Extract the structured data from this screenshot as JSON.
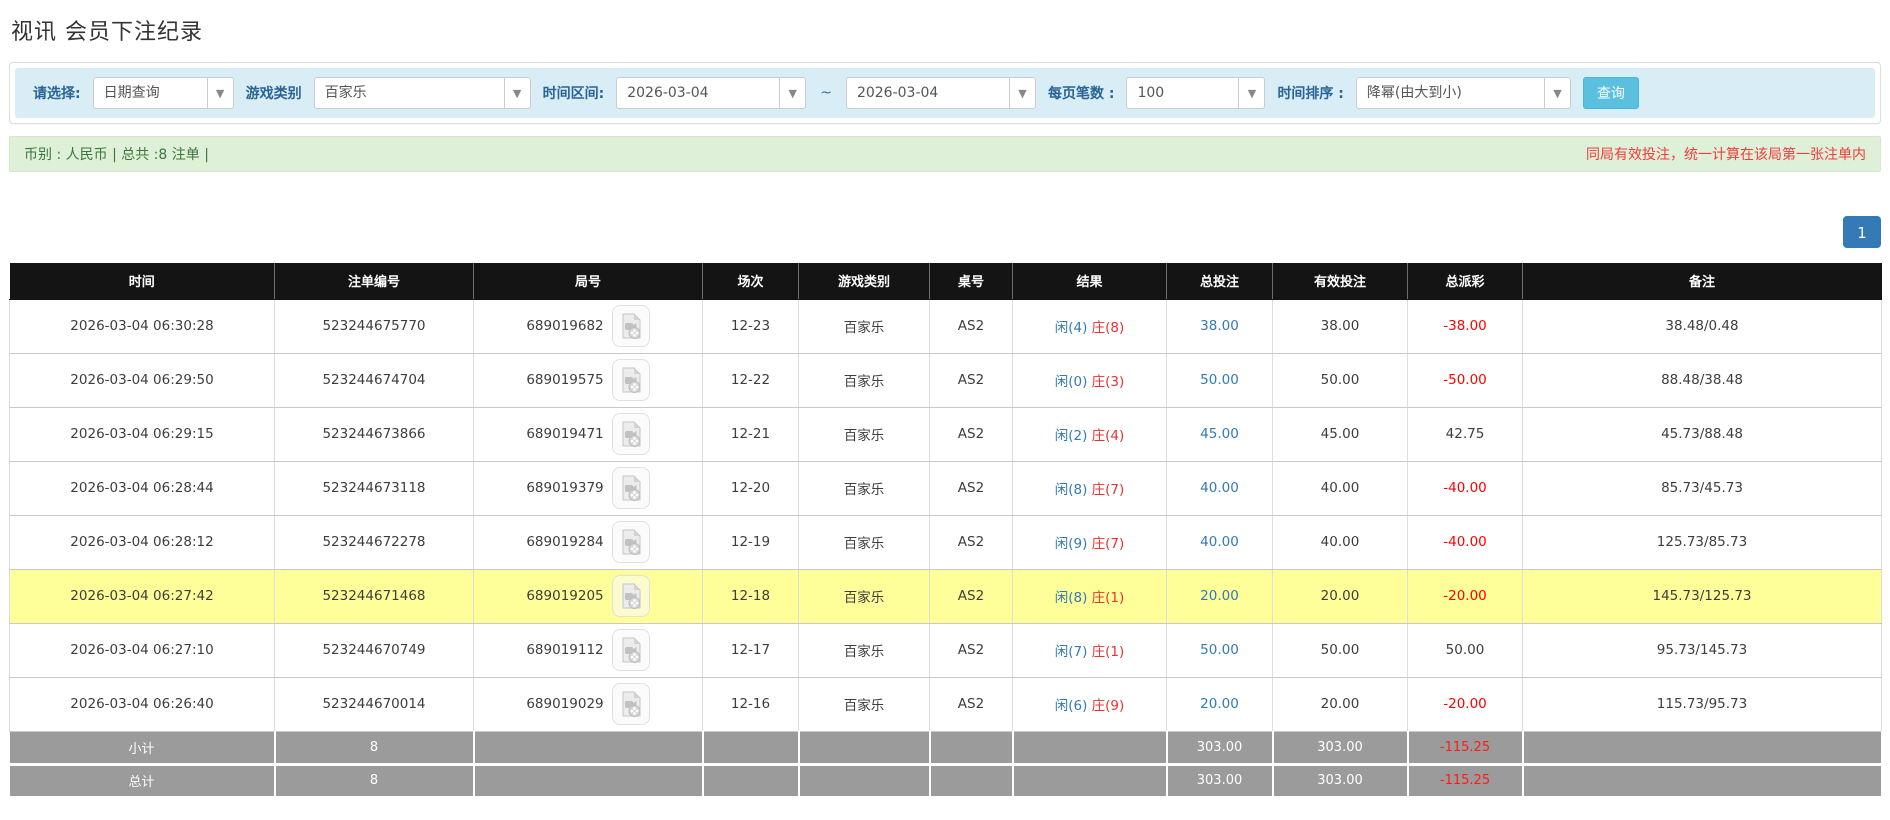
{
  "page": {
    "title": "视讯 会员下注纪录"
  },
  "filters": {
    "select_label": "请选择:",
    "select_value": "日期查询",
    "game_label": "游戏类别",
    "game_value": "百家乐",
    "range_label": "时间区间:",
    "date_from": "2026-03-04",
    "date_to": "2026-03-04",
    "range_separator": "~",
    "per_page_label": "每页笔数 :",
    "per_page_value": "100",
    "sort_label": "时间排序 :",
    "sort_value": "降幂(由大到小)",
    "search_button": "查询",
    "dropdown_arrow": "▼"
  },
  "summary_bar": {
    "left_text": "币别 : 人民币 | 总共 :8 注单 |",
    "right_text": "同局有效投注，统一计算在该局第一张注单内"
  },
  "pagination": {
    "current": "1"
  },
  "table": {
    "headers": [
      "时间",
      "注单编号",
      "局号",
      "场次",
      "游戏类别",
      "桌号",
      "结果",
      "总投注",
      "有效投注",
      "总派彩",
      "备注"
    ],
    "rows": [
      {
        "time": "2026-03-04 06:30:28",
        "bet_id": "523244675770",
        "round_id": "689019682",
        "session": "12-23",
        "game": "百家乐",
        "table_no": "AS2",
        "result_p": "闲(4)",
        "result_b": "庄(8)",
        "total_bet": "38.00",
        "valid_bet": "38.00",
        "payout": "-38.00",
        "payout_neg": true,
        "remark": "38.48/0.48",
        "highlight": false
      },
      {
        "time": "2026-03-04 06:29:50",
        "bet_id": "523244674704",
        "round_id": "689019575",
        "session": "12-22",
        "game": "百家乐",
        "table_no": "AS2",
        "result_p": "闲(0)",
        "result_b": "庄(3)",
        "total_bet": "50.00",
        "valid_bet": "50.00",
        "payout": "-50.00",
        "payout_neg": true,
        "remark": "88.48/38.48",
        "highlight": false
      },
      {
        "time": "2026-03-04 06:29:15",
        "bet_id": "523244673866",
        "round_id": "689019471",
        "session": "12-21",
        "game": "百家乐",
        "table_no": "AS2",
        "result_p": "闲(2)",
        "result_b": "庄(4)",
        "total_bet": "45.00",
        "valid_bet": "45.00",
        "payout": "42.75",
        "payout_neg": false,
        "remark": "45.73/88.48",
        "highlight": false
      },
      {
        "time": "2026-03-04 06:28:44",
        "bet_id": "523244673118",
        "round_id": "689019379",
        "session": "12-20",
        "game": "百家乐",
        "table_no": "AS2",
        "result_p": "闲(8)",
        "result_b": "庄(7)",
        "total_bet": "40.00",
        "valid_bet": "40.00",
        "payout": "-40.00",
        "payout_neg": true,
        "remark": "85.73/45.73",
        "highlight": false
      },
      {
        "time": "2026-03-04 06:28:12",
        "bet_id": "523244672278",
        "round_id": "689019284",
        "session": "12-19",
        "game": "百家乐",
        "table_no": "AS2",
        "result_p": "闲(9)",
        "result_b": "庄(7)",
        "total_bet": "40.00",
        "valid_bet": "40.00",
        "payout": "-40.00",
        "payout_neg": true,
        "remark": "125.73/85.73",
        "highlight": false
      },
      {
        "time": "2026-03-04 06:27:42",
        "bet_id": "523244671468",
        "round_id": "689019205",
        "session": "12-18",
        "game": "百家乐",
        "table_no": "AS2",
        "result_p": "闲(8)",
        "result_b": "庄(1)",
        "total_bet": "20.00",
        "valid_bet": "20.00",
        "payout": "-20.00",
        "payout_neg": true,
        "remark": "145.73/125.73",
        "highlight": true
      },
      {
        "time": "2026-03-04 06:27:10",
        "bet_id": "523244670749",
        "round_id": "689019112",
        "session": "12-17",
        "game": "百家乐",
        "table_no": "AS2",
        "result_p": "闲(7)",
        "result_b": "庄(1)",
        "total_bet": "50.00",
        "valid_bet": "50.00",
        "payout": "50.00",
        "payout_neg": false,
        "remark": "95.73/145.73",
        "highlight": false
      },
      {
        "time": "2026-03-04 06:26:40",
        "bet_id": "523244670014",
        "round_id": "689019029",
        "session": "12-16",
        "game": "百家乐",
        "table_no": "AS2",
        "result_p": "闲(6)",
        "result_b": "庄(9)",
        "total_bet": "20.00",
        "valid_bet": "20.00",
        "payout": "-20.00",
        "payout_neg": true,
        "remark": "115.73/95.73",
        "highlight": false
      }
    ],
    "subtotal": {
      "label": "小计",
      "count": "8",
      "total_bet": "303.00",
      "valid_bet": "303.00",
      "payout": "-115.25"
    },
    "total": {
      "label": "总计",
      "count": "8",
      "total_bet": "303.00",
      "valid_bet": "303.00",
      "payout": "-115.25"
    }
  },
  "colors": {
    "accent_button": "#5bc0de",
    "pagination_active": "#337ab7",
    "link_blue": "#337ab7",
    "banker_red": "#e63333",
    "negative_red": "#ff0000",
    "highlight_row": "#ffff99",
    "header_black": "#141414",
    "summary_gray": "#9b9b9b",
    "alert_green_bg": "#dff0d8",
    "filter_bar_bg": "#d9edf7"
  }
}
